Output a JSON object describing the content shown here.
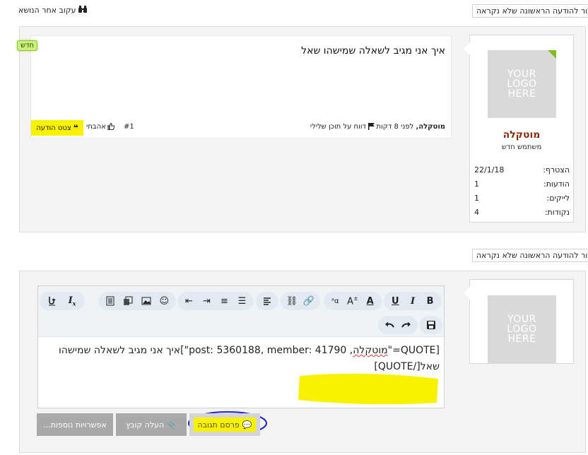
{
  "top": {
    "jump_first_unread": "עבור להודעה הראשונה שלא נקראה",
    "watch_thread": "עקוב אחר הנושא"
  },
  "post1": {
    "user": {
      "logo_text_1": "YOUR",
      "logo_text_2": "LOGO",
      "logo_text_3": "HERE",
      "name": "מוטקלה",
      "title": "משתמש חדש",
      "stats": [
        {
          "label": "הצטרף:",
          "value": "22/1/18"
        },
        {
          "label": "הודעות:",
          "value": "1"
        },
        {
          "label": "לייקים:",
          "value": "1"
        },
        {
          "label": "נקודות:",
          "value": "4"
        }
      ]
    },
    "badge": "חדש",
    "text": "איך אני מגיב לשאלה שמישהו שאל",
    "meta_author": "מוטקלה,",
    "meta_time": "לפני 8 דקות",
    "report": "דווח על תוכן שלילי",
    "post_number": "#1",
    "like": "אהבתי",
    "quote": "צטט הודעה"
  },
  "reply": {
    "jump_first_unread": "עבור להודעה הראשונה שלא נקראה",
    "user": {
      "logo_text_1": "YOUR",
      "logo_text_2": "LOGO",
      "logo_text_3": "HERE"
    },
    "editor_line1_prefix": "[QUOTE=\"",
    "editor_line1_name": "מוטקלה",
    "editor_line1_rest": ", post: 5360188, member: 41790\"]איך אני מגיב לשאלה שמישהו",
    "editor_line2": "שאל[/QUOTE]",
    "post_button": "פרסם תגובה",
    "upload_button": "העלה קובץ",
    "more_options": "אפשרויות נוספות..."
  },
  "colors": {
    "highlight": "#f8f200",
    "username": "#8a2a0a",
    "annotation_circle": "#1a22d6",
    "badge_green": "#c9f07a",
    "corner_green": "#7dbb29"
  }
}
